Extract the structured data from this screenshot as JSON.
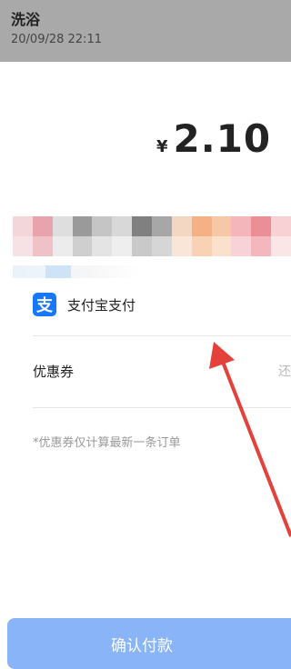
{
  "header": {
    "title": "洗浴",
    "time": "20/09/28 22:11"
  },
  "payment": {
    "currency": "¥",
    "amount": "2.10"
  },
  "methods": {
    "alipay_icon_glyph": "支",
    "alipay_label": "支付宝支付"
  },
  "coupon": {
    "label": "优惠券",
    "right_text": "还"
  },
  "note": "*优惠券仅计算最新一条订单",
  "footer": {
    "confirm_label": "确认付款"
  },
  "colors": {
    "topbar": "#a9a9a9",
    "alipay_blue": "#1677ff",
    "button": "#8ab4f8",
    "arrow": "#e3413a"
  }
}
